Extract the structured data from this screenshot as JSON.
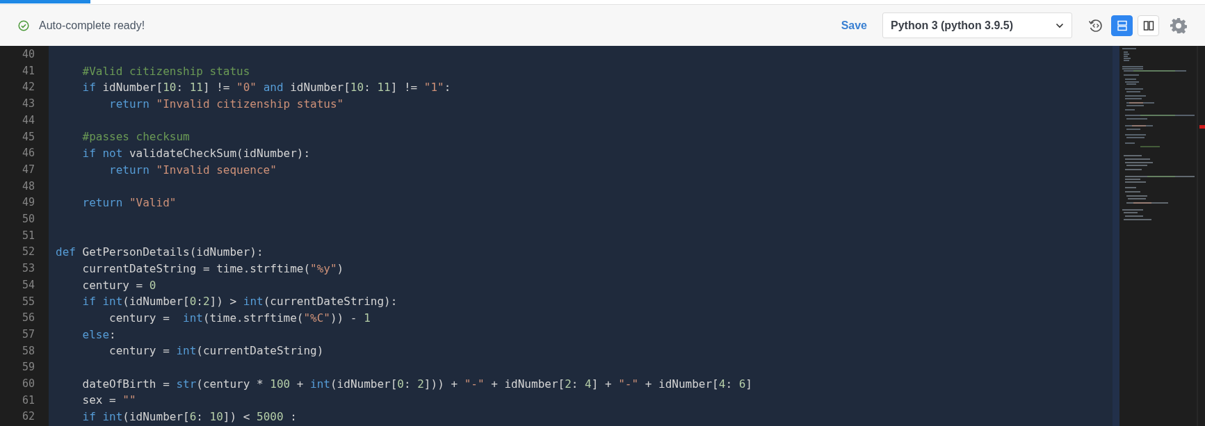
{
  "progress": {
    "level": 0.075
  },
  "status": {
    "text": "Auto-complete ready!"
  },
  "toolbar": {
    "save": "Save",
    "language": {
      "value": "Python 3 (python 3.9.5)"
    },
    "layout_buttons": [
      {
        "kind": "rows",
        "selected": true
      },
      {
        "kind": "columns",
        "selected": false
      }
    ]
  },
  "editor": {
    "lines": [
      {
        "number": "40"
      },
      {
        "number": "41",
        "tokens": [
          {
            "kind": "comment",
            "text": "    #Valid citizenship status"
          }
        ]
      },
      {
        "number": "42",
        "tokens": [
          {
            "kind": "keyword",
            "text": "    if"
          },
          {
            "kind": "plain",
            "text": " idNumber["
          },
          {
            "kind": "number",
            "text": "10"
          },
          {
            "kind": "plain",
            "text": ": "
          },
          {
            "kind": "number",
            "text": "11"
          },
          {
            "kind": "plain",
            "text": "] != "
          },
          {
            "kind": "string",
            "text": "\"0\""
          },
          {
            "kind": "keyword",
            "text": " and"
          },
          {
            "kind": "plain",
            "text": " idNumber["
          },
          {
            "kind": "number",
            "text": "10"
          },
          {
            "kind": "plain",
            "text": ": "
          },
          {
            "kind": "number",
            "text": "11"
          },
          {
            "kind": "plain",
            "text": "] != "
          },
          {
            "kind": "string",
            "text": "\"1\""
          },
          {
            "kind": "plain",
            "text": ":"
          }
        ]
      },
      {
        "number": "43",
        "tokens": [
          {
            "kind": "keyword",
            "text": "        return"
          },
          {
            "kind": "string",
            "text": " \"Invalid citizenship status\""
          }
        ]
      },
      {
        "number": "44"
      },
      {
        "number": "45",
        "tokens": [
          {
            "kind": "comment",
            "text": "    #passes checksum"
          }
        ]
      },
      {
        "number": "46",
        "tokens": [
          {
            "kind": "keyword",
            "text": "    if"
          },
          {
            "kind": "keyword",
            "text": " not"
          },
          {
            "kind": "plain",
            "text": " validateCheckSum(idNumber):"
          }
        ]
      },
      {
        "number": "47",
        "tokens": [
          {
            "kind": "keyword",
            "text": "        return"
          },
          {
            "kind": "string",
            "text": " \"Invalid sequence\""
          }
        ]
      },
      {
        "number": "48"
      },
      {
        "number": "49",
        "tokens": [
          {
            "kind": "keyword",
            "text": "    return"
          },
          {
            "kind": "string",
            "text": " \"Valid\""
          }
        ]
      },
      {
        "number": "50"
      },
      {
        "number": "51"
      },
      {
        "number": "52",
        "tokens": [
          {
            "kind": "keyword",
            "text": "def"
          },
          {
            "kind": "plain",
            "text": " GetPersonDetails(idNumber):"
          }
        ]
      },
      {
        "number": "53",
        "tokens": [
          {
            "kind": "plain",
            "text": "    currentDateString = time.strftime("
          },
          {
            "kind": "string",
            "text": "\"%y\""
          },
          {
            "kind": "plain",
            "text": ")"
          }
        ]
      },
      {
        "number": "54",
        "tokens": [
          {
            "kind": "plain",
            "text": "    century = "
          },
          {
            "kind": "number",
            "text": "0"
          }
        ]
      },
      {
        "number": "55",
        "tokens": [
          {
            "kind": "keyword",
            "text": "    if"
          },
          {
            "kind": "keyword",
            "text": " int"
          },
          {
            "kind": "plain",
            "text": "(idNumber["
          },
          {
            "kind": "number",
            "text": "0"
          },
          {
            "kind": "plain",
            "text": ":"
          },
          {
            "kind": "number",
            "text": "2"
          },
          {
            "kind": "plain",
            "text": "]) > "
          },
          {
            "kind": "keyword",
            "text": "int"
          },
          {
            "kind": "plain",
            "text": "(currentDateString):"
          }
        ]
      },
      {
        "number": "56",
        "tokens": [
          {
            "kind": "plain",
            "text": "        century =  "
          },
          {
            "kind": "keyword",
            "text": "int"
          },
          {
            "kind": "plain",
            "text": "(time.strftime("
          },
          {
            "kind": "string",
            "text": "\"%C\""
          },
          {
            "kind": "plain",
            "text": ")) - "
          },
          {
            "kind": "number",
            "text": "1"
          }
        ]
      },
      {
        "number": "57",
        "tokens": [
          {
            "kind": "keyword",
            "text": "    else"
          },
          {
            "kind": "plain",
            "text": ":"
          }
        ]
      },
      {
        "number": "58",
        "tokens": [
          {
            "kind": "plain",
            "text": "        century = "
          },
          {
            "kind": "keyword",
            "text": "int"
          },
          {
            "kind": "plain",
            "text": "(currentDateString)"
          }
        ]
      },
      {
        "number": "59"
      },
      {
        "number": "60",
        "tokens": [
          {
            "kind": "plain",
            "text": "    dateOfBirth = "
          },
          {
            "kind": "keyword",
            "text": "str"
          },
          {
            "kind": "plain",
            "text": "(century * "
          },
          {
            "kind": "number",
            "text": "100"
          },
          {
            "kind": "plain",
            "text": " + "
          },
          {
            "kind": "keyword",
            "text": "int"
          },
          {
            "kind": "plain",
            "text": "(idNumber["
          },
          {
            "kind": "number",
            "text": "0"
          },
          {
            "kind": "plain",
            "text": ": "
          },
          {
            "kind": "number",
            "text": "2"
          },
          {
            "kind": "plain",
            "text": "])) + "
          },
          {
            "kind": "string",
            "text": "\"-\""
          },
          {
            "kind": "plain",
            "text": " + idNumber["
          },
          {
            "kind": "number",
            "text": "2"
          },
          {
            "kind": "plain",
            "text": ": "
          },
          {
            "kind": "number",
            "text": "4"
          },
          {
            "kind": "plain",
            "text": "] + "
          },
          {
            "kind": "string",
            "text": "\"-\""
          },
          {
            "kind": "plain",
            "text": " + idNumber["
          },
          {
            "kind": "number",
            "text": "4"
          },
          {
            "kind": "plain",
            "text": ": "
          },
          {
            "kind": "number",
            "text": "6"
          },
          {
            "kind": "plain",
            "text": "]"
          }
        ]
      },
      {
        "number": "61",
        "tokens": [
          {
            "kind": "plain",
            "text": "    sex = "
          },
          {
            "kind": "string",
            "text": "\"\""
          }
        ]
      },
      {
        "number": "62",
        "tokens": [
          {
            "kind": "keyword",
            "text": "    if"
          },
          {
            "kind": "keyword",
            "text": " int"
          },
          {
            "kind": "plain",
            "text": "(idNumber["
          },
          {
            "kind": "number",
            "text": "6"
          },
          {
            "kind": "plain",
            "text": ": "
          },
          {
            "kind": "number",
            "text": "10"
          },
          {
            "kind": "plain",
            "text": "]) < "
          },
          {
            "kind": "number",
            "text": "5000"
          },
          {
            "kind": "plain",
            "text": " :"
          }
        ]
      }
    ]
  }
}
